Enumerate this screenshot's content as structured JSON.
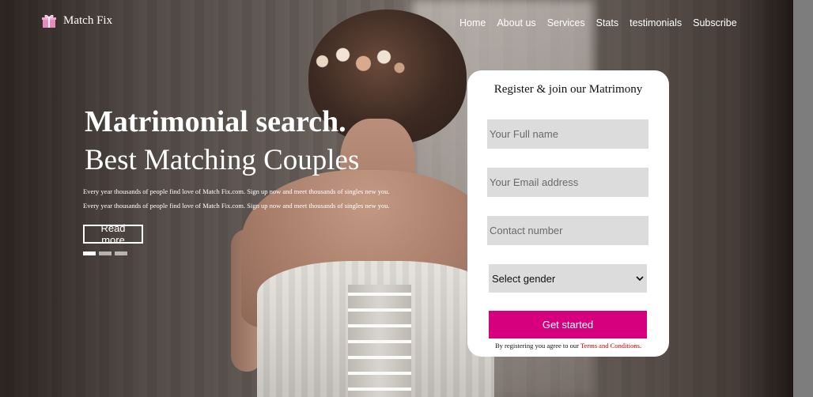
{
  "brand": {
    "name": "Match Fix",
    "icon": "gift-icon"
  },
  "nav": {
    "items": [
      "Home",
      "About us",
      "Services",
      "Stats",
      "testimonials",
      "Subscribe"
    ]
  },
  "hero": {
    "title": "Matrimonial search.",
    "subtitle": "Best Matching Couples",
    "paragraph_lines": [
      "Every year thousands of people find love of Match Fix.com. Sign up now and meet thousands of singles new you.",
      "Every year thousands of people find love of Match Fix.com. Sign up now and meet thousands of singles new you."
    ],
    "read_more": "Read more",
    "slides": {
      "count": 3,
      "active_index": 0
    }
  },
  "form": {
    "title": "Register & join our Matrimony",
    "full_name_placeholder": "Your Full name",
    "email_placeholder": "Your Email address",
    "contact_placeholder": "Contact number",
    "gender_select": {
      "selected": "Select gender"
    },
    "submit_label": "Get started",
    "terms_prefix": "By registering you agree to our ",
    "terms_link": "Terms and Conditions."
  },
  "colors": {
    "accent": "#d6007f",
    "terms_link": "#cc0000",
    "field_bg": "#dcdcdc"
  }
}
